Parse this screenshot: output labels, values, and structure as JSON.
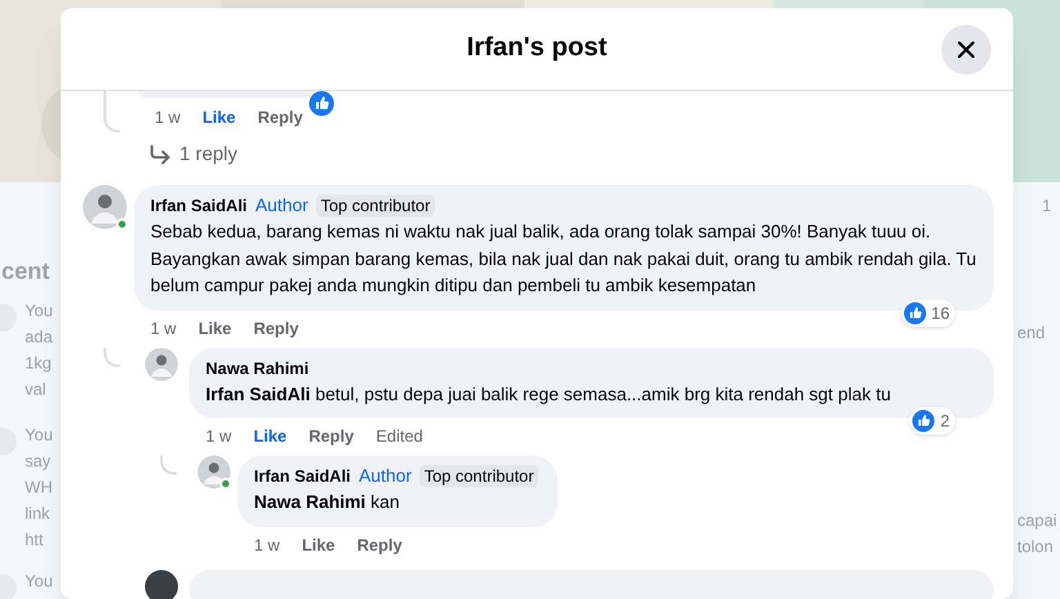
{
  "background": {
    "heading": "cent",
    "left_snippets": [
      [
        "You",
        "ada",
        "1kg",
        "val"
      ],
      [
        "You",
        "say",
        "WH",
        "link",
        "htt"
      ],
      [
        "You"
      ]
    ],
    "right_texts": [
      "1",
      "end",
      "capai",
      "tolon"
    ]
  },
  "modal": {
    "title": "Irfan's post"
  },
  "previous_comment": {
    "time": "1 w",
    "liked": true,
    "like_label": "Like",
    "reply_label": "Reply",
    "replies_link": "1 reply"
  },
  "comments": [
    {
      "name": "Irfan SaidAli",
      "badges": [
        {
          "kind": "author",
          "label": "Author"
        },
        {
          "kind": "contributor",
          "label": "Top contributor"
        }
      ],
      "online": true,
      "text": "Sebab kedua, barang kemas ni waktu nak jual balik, ada orang tolak sampai 30%! Banyak tuuu oi. Bayangkan awak simpan barang kemas, bila nak jual dan nak pakai duit, orang tu ambik rendah gila. Tu belum campur pakej anda mungkin ditipu dan pembeli tu ambik kesempatan",
      "time": "1 w",
      "liked": false,
      "like_label": "Like",
      "reply_label": "Reply",
      "edited": false,
      "reactions": "16",
      "children": [
        {
          "name": "Nawa Rahimi",
          "online": false,
          "text": "**Irfan SaidAli** betul, pstu depa juai balik rege semasa...amik brg kita rendah sgt plak tu",
          "time": "1 w",
          "liked": true,
          "like_label": "Like",
          "reply_label": "Reply",
          "edited": true,
          "edited_label": "Edited",
          "reactions": "2",
          "children": [
            {
              "name": "Irfan SaidAli",
              "badges": [
                {
                  "kind": "author",
                  "label": "Author"
                },
                {
                  "kind": "contributor",
                  "label": "Top contributor"
                }
              ],
              "online": true,
              "text": "**Nawa Rahimi** kan",
              "time": "1 w",
              "liked": false,
              "like_label": "Like",
              "reply_label": "Reply",
              "edited": false
            }
          ]
        }
      ]
    }
  ]
}
